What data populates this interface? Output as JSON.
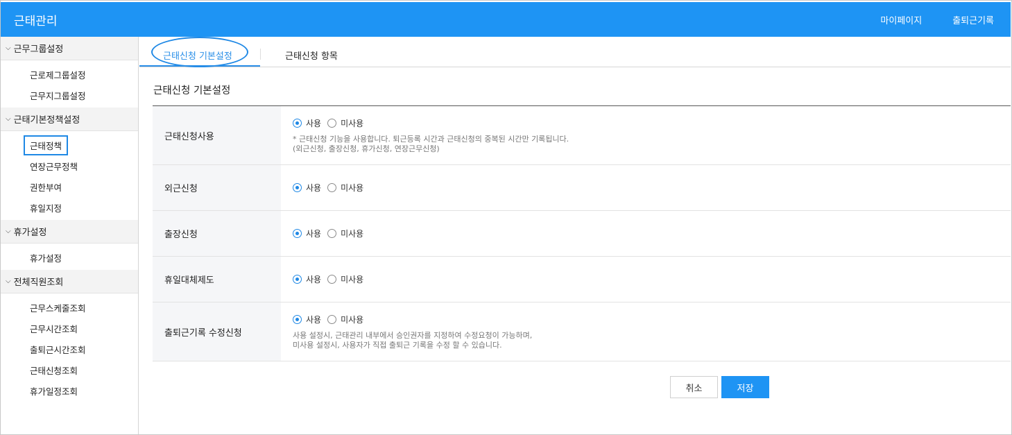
{
  "header": {
    "title": "근태관리",
    "links": [
      "마이페이지",
      "출퇴근기록"
    ]
  },
  "sidebar": {
    "groups": [
      {
        "label": "근무그룹설정",
        "items": [
          "근로제그룹설정",
          "근무지그룹설정"
        ]
      },
      {
        "label": "근태기본정책설정",
        "items": [
          "근태정책",
          "연장근무정책",
          "권한부여",
          "휴일지정"
        ]
      },
      {
        "label": "휴가설정",
        "items": [
          "휴가설정"
        ]
      },
      {
        "label": "전체직원조회",
        "items": [
          "근무스케줄조회",
          "근무시간조회",
          "출퇴근시간조회",
          "근태신청조회",
          "휴가일정조회"
        ]
      }
    ],
    "active_item": "근태정책"
  },
  "tabs": {
    "tab1": "근태신청 기본설정",
    "tab2": "근태신청 항목"
  },
  "section_title": "근태신청 기본설정",
  "options": {
    "use": "사용",
    "not_use": "미사용"
  },
  "rows": [
    {
      "label": "근태신청사용",
      "selected": "사용",
      "desc1": "* 근태신청 기능을 사용합니다. 퇴근등록 시간과 근태신청의 중복된 시간만 기록됩니다.",
      "desc2": "(외근신청, 출장신청, 휴가신청, 연장근무신청)"
    },
    {
      "label": "외근신청",
      "selected": "사용"
    },
    {
      "label": "출장신청",
      "selected": "사용"
    },
    {
      "label": "휴일대체제도",
      "selected": "사용"
    },
    {
      "label": "출퇴근기록 수정신청",
      "selected": "사용",
      "desc1": "사용 설정시, 근태관리 내부에서 승인권자를 지정하여 수정요청이 가능하며,",
      "desc2": "미사용 설정시, 사용자가 직접 출퇴근 기록을 수정 할 수 있습니다."
    }
  ],
  "buttons": {
    "cancel": "취소",
    "save": "저장"
  }
}
